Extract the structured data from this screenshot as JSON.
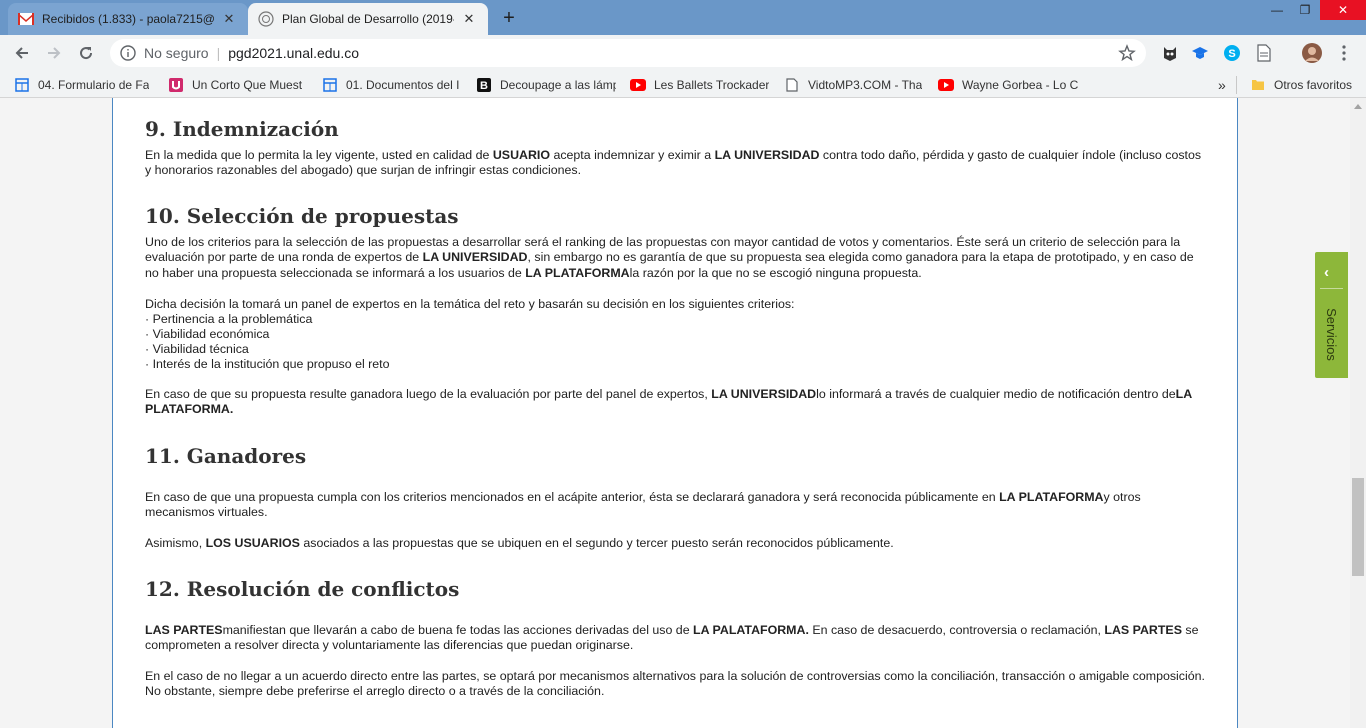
{
  "browser": {
    "tabs": [
      {
        "title": "Recibidos (1.833) - paola7215@g",
        "favicon": "gmail-icon"
      },
      {
        "title": "Plan Global de Desarrollo (2019-",
        "favicon": "unal-seal-icon"
      }
    ],
    "url": {
      "security": "No seguro",
      "host": "pgd2021.unal.edu.co"
    },
    "bookmarks": [
      {
        "label": "04. Formulario de Fa",
        "icon": "calendar-icon"
      },
      {
        "label": "Un Corto Que Muest",
        "icon": "u-logo-icon"
      },
      {
        "label": "01. Documentos del I",
        "icon": "calendar-icon"
      },
      {
        "label": "Decoupage a las lámp",
        "icon": "b-logo-icon"
      },
      {
        "label": "Les Ballets Trockader",
        "icon": "youtube-icon"
      },
      {
        "label": "VidtoMP3.COM - Tha",
        "icon": "page-icon"
      },
      {
        "label": "Wayne Gorbea - Lo C",
        "icon": "youtube-icon"
      }
    ],
    "more_bookmarks": "»",
    "other_bookmarks": "Otros favoritos"
  },
  "sidebar_tab": {
    "label": "Servicios"
  },
  "sections": {
    "s9": {
      "title": "9.  Indemnización",
      "p1": {
        "a": "En la medida que lo permita la ley vigente, usted en calidad de ",
        "b1": "USUARIO",
        "c": " acepta indemnizar y eximir a ",
        "b2": "LA UNIVERSIDAD",
        "d": " contra todo daño, pérdida y gasto de cualquier índole (incluso costos y honorarios razonables del abogado) que surjan de infringir estas condiciones."
      }
    },
    "s10": {
      "title": "10. Selección de propuestas",
      "p1": {
        "a": "Uno de los criterios para la selección de las propuestas a desarrollar será el ranking de las propuestas con mayor cantidad de votos y comentarios. Éste será un criterio de selección para la evaluación por parte de una ronda de expertos de ",
        "b1": "LA UNIVERSIDAD",
        "c": ", sin embargo no es garantía de que su propuesta sea elegida como ganadora para la etapa de prototipado, y en caso de no haber una propuesta seleccionada se informará a los usuarios de ",
        "b2": "LA PLATAFORMA",
        "d": "la razón por la que no se escogió ninguna propuesta."
      },
      "p2": "Dicha decisión la tomará un panel de expertos en la temática del reto y basarán su decisión en los siguientes criterios:",
      "criteria": [
        "· Pertinencia a la problemática",
        "· Viabilidad económica",
        "· Viabilidad técnica",
        "· Interés de la institución que propuso el reto"
      ],
      "p3": {
        "a": "En caso de que su propuesta resulte ganadora luego de la evaluación por parte del panel de expertos, ",
        "b1": "LA UNIVERSIDAD",
        "c": "lo informará a través de cualquier medio de notificación dentro de",
        "b2": "LA PLATAFORMA."
      }
    },
    "s11": {
      "title": "11. Ganadores",
      "p1": {
        "a": "En caso de que una propuesta cumpla con los criterios mencionados en el acápite anterior, ésta se declarará ganadora y será reconocida públicamente en ",
        "b1": "LA PLATAFORMA",
        "c": "y otros mecanismos virtuales."
      },
      "p2": {
        "a": "Asimismo, ",
        "b1": "LOS USUARIOS",
        "c": " asociados a las propuestas que se ubiquen en el segundo y tercer puesto serán reconocidos públicamente."
      }
    },
    "s12": {
      "title": "12. Resolución de conflictos",
      "p1": {
        "b1": "LAS PARTES",
        "a": "manifiestan que llevarán a cabo de buena fe todas las acciones derivadas del uso de ",
        "b2": "LA PALATAFORMA.",
        "c": " En caso de desacuerdo, controversia o reclamación, ",
        "b3": "LAS PARTES",
        "d": " se comprometen a resolver directa y voluntariamente las diferencias que puedan originarse."
      },
      "p2": "En el caso de no llegar a un acuerdo directo entre las partes, se optará por mecanismos alternativos para la solución de controversias como la conciliación, transacción o amigable composición. No obstante, siempre debe preferirse el arreglo directo o a través de la conciliación."
    }
  }
}
